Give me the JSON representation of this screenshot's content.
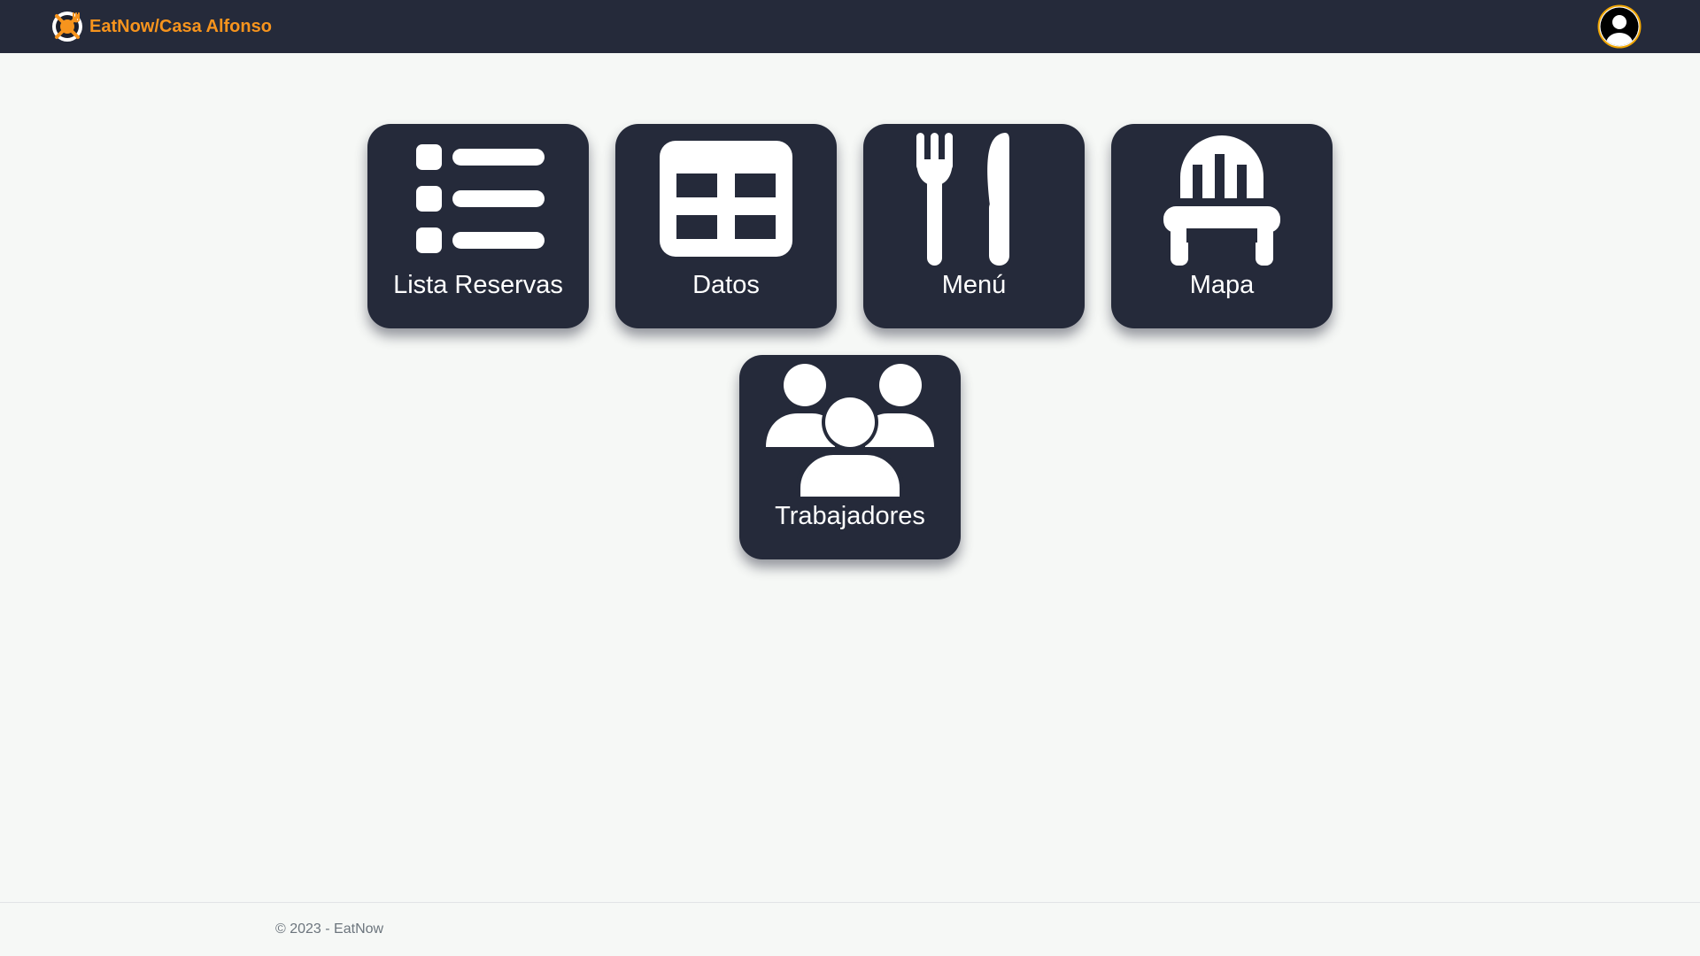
{
  "header": {
    "brand": "EatNow/Casa Alfonso",
    "logo_icon": "fork-knife-plate-logo-icon",
    "account_icon": "user-circle-icon"
  },
  "tiles": [
    {
      "label": "Lista Reservas",
      "icon": "list-icon"
    },
    {
      "label": "Datos",
      "icon": "table-icon"
    },
    {
      "label": "Menú",
      "icon": "fork-knife-icon"
    },
    {
      "label": "Mapa",
      "icon": "chair-icon"
    },
    {
      "label": "Trabajadores",
      "icon": "users-group-icon"
    }
  ],
  "footer": {
    "text": "© 2023 - EatNow"
  },
  "colors": {
    "header_bg": "#252a3a",
    "brand_accent": "#f7941d",
    "tile_bg": "#252a3a",
    "page_bg": "#f6f8f6"
  }
}
